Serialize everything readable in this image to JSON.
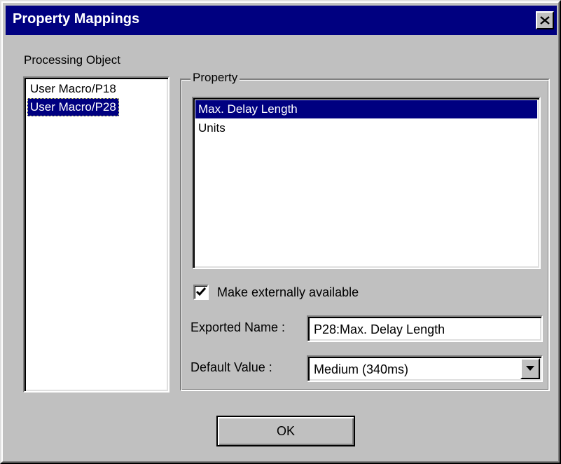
{
  "window": {
    "title": "Property Mappings",
    "close_icon": "close-icon"
  },
  "processing_object": {
    "label": "Processing Object",
    "items": [
      {
        "label": "User Macro/P18",
        "selected": false
      },
      {
        "label": "User Macro/P28",
        "selected": true
      }
    ]
  },
  "property": {
    "group_label": "Property",
    "items": [
      {
        "label": "Max. Delay Length",
        "selected": true
      },
      {
        "label": "Units",
        "selected": false
      }
    ]
  },
  "export": {
    "checkbox_label": "Make externally available",
    "checkbox_checked": true,
    "exported_name_label": "Exported Name :",
    "exported_name_value": "P28:Max. Delay Length",
    "default_value_label": "Default Value :",
    "default_value_selected": "Medium (340ms)"
  },
  "buttons": {
    "ok_label": "OK"
  },
  "colors": {
    "title_bar": "#000080",
    "dialog_bg": "#c0c0c0",
    "selection": "#000080"
  }
}
